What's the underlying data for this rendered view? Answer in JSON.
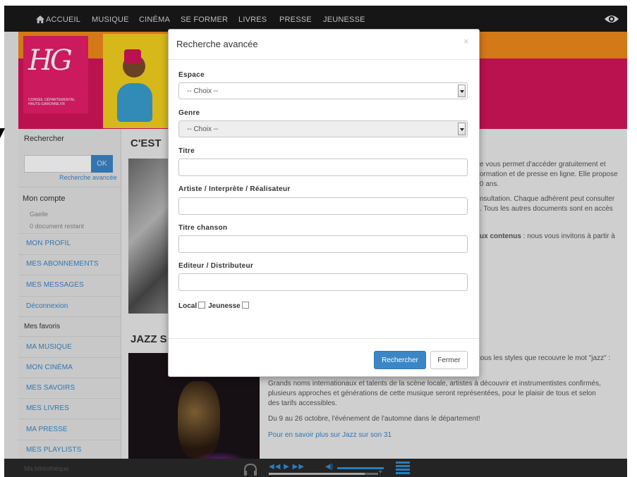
{
  "nav": {
    "items": [
      "ACCUEIL",
      "MUSIQUE",
      "CINÉMA",
      "SE FORMER",
      "LIVRES",
      "PRESSE",
      "JEUNESSE"
    ],
    "home_icon": "home-icon",
    "eye_icon": "eye-icon"
  },
  "logo": {
    "letters": "HG",
    "subtitle": "CONSEIL DÉPARTEMENTAL HAUTE-GARONNE.FR"
  },
  "sidebar": {
    "search_label": "Rechercher",
    "ok_label": "OK",
    "advanced_link": "Recherche avancée",
    "account_title": "Mon compte",
    "user_name": "Gaelle",
    "documents_left": "0 document restant",
    "account_links": [
      "MON PROFIL",
      "MES ABONNEMENTS",
      "MES MESSAGES",
      "Déconnexion"
    ],
    "favorites_title": "Mes favoris",
    "favorite_links": [
      "MA MUSIQUE",
      "MON CINÉMA",
      "MES SAVOIRS",
      "MES LIVRES",
      "MA PRESSE",
      "MES PLAYLISTS"
    ],
    "bottom_item": "Ma bibliothèque"
  },
  "content": {
    "heading1": "C'EST",
    "heading2": "JAZZ S",
    "para1_lines": [
      "e vous permet d'accéder gratuitement et",
      "ormation et de presse en ligne. Elle propose",
      "0 ans."
    ],
    "para2_lines": [
      "nsultation. Chaque adhérent peut consulter",
      ". Tous les autres documents sont en accès"
    ],
    "para3_bold": "ux contenus",
    "para3_rest": " : nous vous invitons à partir à",
    "jazz_line1": "tous les styles que recouvre le mot \"jazz\" :",
    "jazz_para_lines": [
      "Grands noms internationaux et talents de la scène locale, artistes à découvrir et instrumentistes confirmés,",
      "plusieurs approches et générations de cette musique seront représentées, pour le plaisir de tous et selon",
      "des tarifs accessibles."
    ],
    "jazz_dates": "Du 9 au 26 octobre, l'événement de l'automne dans le département!",
    "jazz_link": "Pour en savoir plus sur Jazz sur son 31"
  },
  "player": {
    "progress": 0.88,
    "icons": [
      "headphones-icon",
      "rewind-icon",
      "play-icon",
      "forward-icon",
      "volume-icon",
      "playlist-icon"
    ],
    "volume_plus": "+"
  },
  "modal": {
    "title": "Recherche avancée",
    "close_symbol": "×",
    "fields": {
      "espace_label": "Espace",
      "espace_value": "-- Choix --",
      "genre_label": "Genre",
      "genre_value": "-- Choix --",
      "titre_label": "Titre",
      "artiste_label": "Artiste / Interprète / Réalisateur",
      "titre_chanson_label": "Titre chanson",
      "editeur_label": "Editeur / Distributeur",
      "local_label": "Local",
      "jeunesse_label": "Jeunesse"
    },
    "search_button": "Rechercher",
    "close_button": "Fermer"
  }
}
